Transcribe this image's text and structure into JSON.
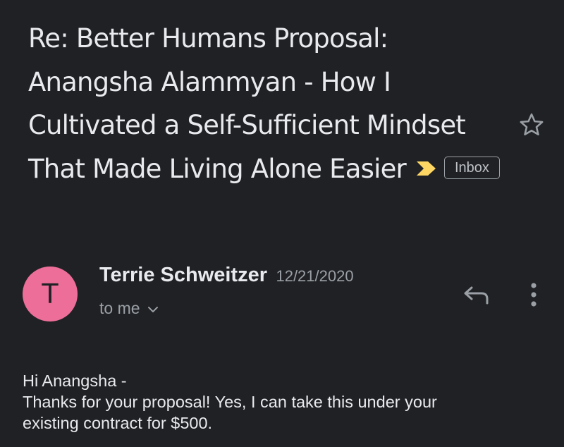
{
  "email": {
    "subject": "Re: Better Humans Proposal: Anangsha Alammyan - How I Cultivated a Self-Sufficient Mindset That Made Living Alone Easier",
    "important_icon": "important-marker-icon",
    "label": "Inbox",
    "star_icon": "star-outline-icon"
  },
  "message": {
    "avatar_letter": "T",
    "sender_name": "Terrie Schweitzer",
    "date": "12/21/2020",
    "recipient": "to me",
    "reply_icon": "reply-icon",
    "more_icon": "more-vert-icon",
    "body_lines": [
      "Hi Anangsha -",
      "Thanks for your proposal! Yes, I can take this under your",
      "existing contract for $500."
    ]
  },
  "colors": {
    "background": "#202124",
    "text_primary": "#e8eaed",
    "text_secondary": "#9aa0a6",
    "avatar": "#ec6e99",
    "important_marker": "#fdd663"
  }
}
